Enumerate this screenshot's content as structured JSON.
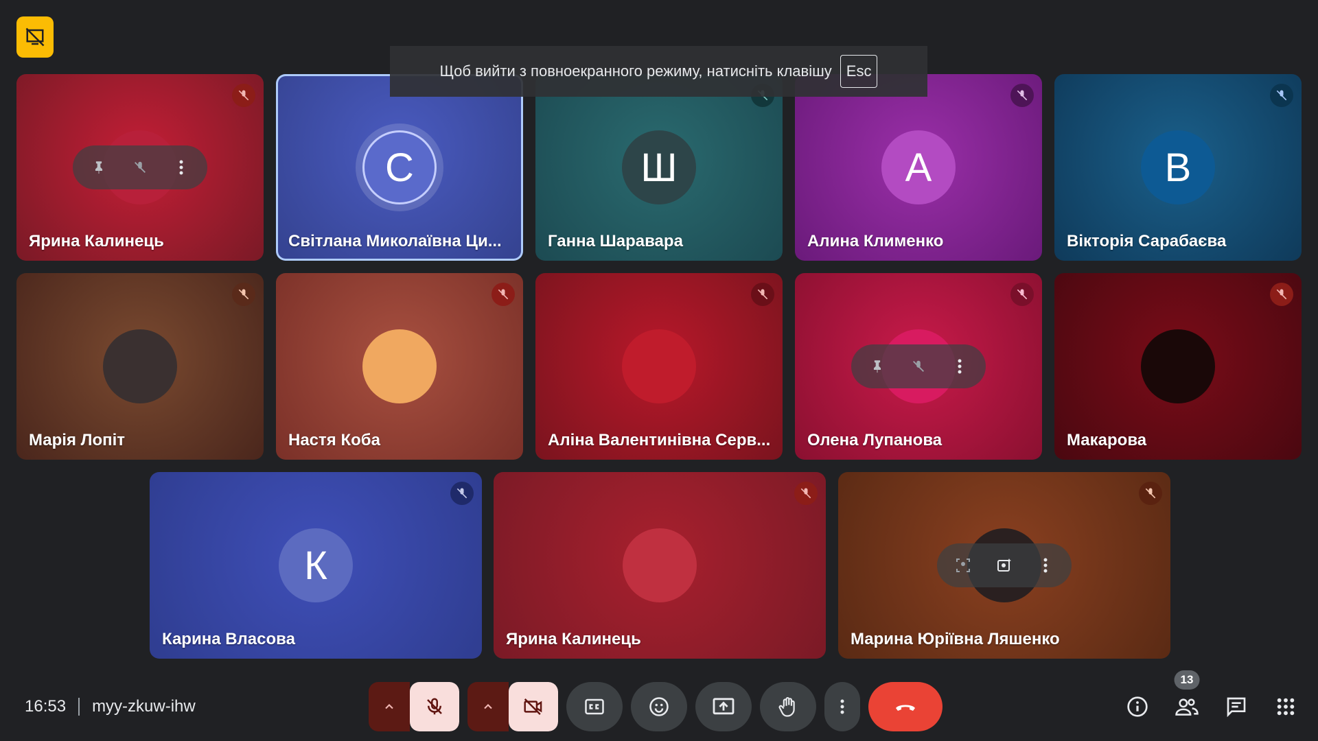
{
  "toast": {
    "text": "Щоб вийти з повноекранного режиму, натисніть клавішу",
    "key": "Esc"
  },
  "tiles": [
    {
      "name": "Ярина Калинець",
      "avatar_letter": "",
      "bg": "#8a1d2c"
    },
    {
      "name": "Світлана Миколаївна Ци...",
      "avatar_letter": "С",
      "bg": "#3c4ba0"
    },
    {
      "name": "Ганна Шаравара",
      "avatar_letter": "Ш",
      "bg": "#1f5357"
    },
    {
      "name": "Алина Клименко",
      "avatar_letter": "А",
      "bg": "#7a1f8a"
    },
    {
      "name": "Вікторія Сарабаєва",
      "avatar_letter": "В",
      "bg": "#114a6e"
    },
    {
      "name": "Марія Лопіт",
      "avatar_letter": "",
      "bg": "#5a2a1e"
    },
    {
      "name": "Настя Коба",
      "avatar_letter": "",
      "bg": "#8a3a30"
    },
    {
      "name": "Аліна Валентинівна Серв...",
      "avatar_letter": "",
      "bg": "#8b1522"
    },
    {
      "name": "Олена Лупанова",
      "avatar_letter": "",
      "bg": "#a0153a"
    },
    {
      "name": "Макарова",
      "avatar_letter": "",
      "bg": "#5a0a12"
    },
    {
      "name": "Карина Власова",
      "avatar_letter": "К",
      "bg": "#3340a0"
    },
    {
      "name": "Ярина Калинець",
      "avatar_letter": "",
      "bg": "#8a1d2c"
    },
    {
      "name": "Марина Юріївна Ляшенко",
      "avatar_letter": "",
      "bg": "#6a3018"
    }
  ],
  "bottom": {
    "time": "16:53",
    "meeting_code": "myy-zkuw-ihw",
    "people_count": "13"
  },
  "colors": {
    "end_call": "#ea4335",
    "badge": "#fbbc04",
    "muted_bg": "#f9dedc"
  }
}
